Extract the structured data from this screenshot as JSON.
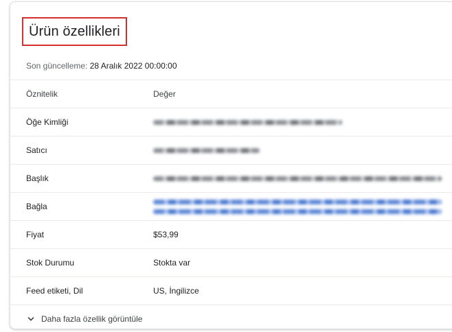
{
  "panel": {
    "title": "Ürün özellikleri",
    "updated_label": "Son güncelleme:",
    "updated_value": "28 Aralık 2022 00:00:00"
  },
  "table": {
    "headers": {
      "attribute": "Öznitelik",
      "value": "Değer"
    },
    "rows": [
      {
        "attribute": "Öğe Kimliği",
        "value": ""
      },
      {
        "attribute": "Satıcı",
        "value": ""
      },
      {
        "attribute": "Başlık",
        "value": ""
      },
      {
        "attribute": "Bağla",
        "value": ""
      },
      {
        "attribute": "Fiyat",
        "value": "$53,99"
      },
      {
        "attribute": "Stok Durumu",
        "value": "Stokta var"
      },
      {
        "attribute": "Feed etiketi, Dil",
        "value": "US, İngilizce"
      }
    ]
  },
  "footer": {
    "more_label": "Daha fazla özellik görüntüle",
    "icon": "chevron-down-icon"
  },
  "colors": {
    "highlight_border": "#d32f2f",
    "link_blur": "#5b86d6"
  }
}
